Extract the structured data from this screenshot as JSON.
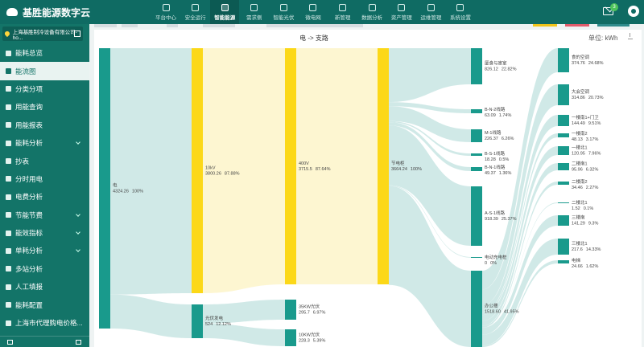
{
  "app": {
    "title": "基胜能源数字云"
  },
  "nav": [
    {
      "label": "平台中心"
    },
    {
      "label": "安全运行"
    },
    {
      "label": "智能能源",
      "active": true
    },
    {
      "label": "需求侧"
    },
    {
      "label": "智能光伏"
    },
    {
      "label": "微电网"
    },
    {
      "label": "新管理"
    },
    {
      "label": "数据分析"
    },
    {
      "label": "资产管理"
    },
    {
      "label": "运维管理"
    },
    {
      "label": "系统设置"
    }
  ],
  "header": {
    "notification_count": "3"
  },
  "site": {
    "selected": "上海基胜制冷设备有限公司-ho..."
  },
  "sidebar": {
    "items": [
      {
        "label": "能耗总览",
        "icon": "gauge-icon",
        "chevron": false
      },
      {
        "label": "能流图",
        "icon": "flow-icon",
        "chevron": false,
        "active": true
      },
      {
        "label": "分类分项",
        "icon": "bars-icon",
        "chevron": false
      },
      {
        "label": "用能查询",
        "icon": "grid-icon",
        "chevron": false
      },
      {
        "label": "用能报表",
        "icon": "table-icon",
        "chevron": false
      },
      {
        "label": "能耗分析",
        "icon": "chart-icon",
        "chevron": true
      },
      {
        "label": "抄表",
        "icon": "meter-icon",
        "chevron": false
      },
      {
        "label": "分时用电",
        "icon": "clock-icon",
        "chevron": false
      },
      {
        "label": "电费分析",
        "icon": "money-icon",
        "chevron": false
      },
      {
        "label": "节能节费",
        "icon": "leaf-icon",
        "chevron": true
      },
      {
        "label": "能效指标",
        "icon": "target-icon",
        "chevron": true
      },
      {
        "label": "单耗分析",
        "icon": "gear-icon",
        "chevron": true
      },
      {
        "label": "多站分析",
        "icon": "sites-icon",
        "chevron": false
      },
      {
        "label": "人工填报",
        "icon": "tools-icon",
        "chevron": false
      },
      {
        "label": "能耗配置",
        "icon": "config-icon",
        "chevron": false
      },
      {
        "label": "上海市代理购电价格...",
        "icon": "doc-icon",
        "chevron": false
      }
    ]
  },
  "card": {
    "title": "电 -> 支路",
    "unit": "单位: kWh"
  },
  "chart_data": {
    "type": "sankey",
    "title": "电 -> 支路",
    "unit": "kWh",
    "colors": {
      "node_teal": "#199a8c",
      "node_yellow": "#fcd818",
      "link_teal": "#cde8e6",
      "link_yellow": "#fdf6cf"
    },
    "nodes": [
      {
        "id": "dian",
        "label": "电",
        "value": "4324.26",
        "pct": "100%",
        "column": 0
      },
      {
        "id": "10kv",
        "label": "10kV",
        "value": "3800.26",
        "pct": "87.88%",
        "column": 1
      },
      {
        "id": "pv",
        "label": "光伏发电",
        "value": "524",
        "pct": "12.12%",
        "column": 1
      },
      {
        "id": "400v",
        "label": "400V",
        "value": "3715.5",
        "pct": "87.64%",
        "column": 2
      },
      {
        "id": "pv35",
        "label": "35KW光伏",
        "value": "295.7",
        "pct": "6.97%",
        "column": 2
      },
      {
        "id": "pv10",
        "label": "10KW光伏",
        "value": "228.3",
        "pct": "5.39%",
        "column": 2
      },
      {
        "id": "jdl",
        "label": "节电柜",
        "value": "3664.24",
        "pct": "100%",
        "column": 3
      },
      {
        "id": "fp",
        "label": "厦食与寄室",
        "value": "826.12",
        "pct": "22.82%",
        "column": 4
      },
      {
        "id": "bn2",
        "label": "B-N-2线路",
        "value": "63.09",
        "pct": "1.74%",
        "column": 4
      },
      {
        "id": "m1",
        "label": "M-1线路",
        "value": "226.37",
        "pct": "6.26%",
        "column": 4
      },
      {
        "id": "bs1",
        "label": "B-S-1线路",
        "value": "18.28",
        "pct": "0.5%",
        "column": 4
      },
      {
        "id": "bn1",
        "label": "B-N-1线路",
        "value": "49.37",
        "pct": "1.36%",
        "column": 4
      },
      {
        "id": "as1",
        "label": "A-S-1线路",
        "value": "918.39",
        "pct": "25.37%",
        "column": 4
      },
      {
        "id": "ev",
        "label": "电动充电桩",
        "value": "0",
        "pct": "0%",
        "column": 4
      },
      {
        "id": "office",
        "label": "办公楼",
        "value": "1518.60",
        "pct": "41.95%",
        "column": 4
      },
      {
        "id": "t1",
        "label": "食的空调",
        "value": "374.76",
        "pct": "24.68%",
        "column": 5
      },
      {
        "id": "t2",
        "label": "大会空调",
        "value": "314.86",
        "pct": "20.73%",
        "column": 5
      },
      {
        "id": "t3",
        "label": "一楼南1+门卫",
        "value": "144.49",
        "pct": "9.51%",
        "column": 5
      },
      {
        "id": "t4",
        "label": "一楼南2",
        "value": "48.13",
        "pct": "3.17%",
        "column": 5
      },
      {
        "id": "t5",
        "label": "一楼北1",
        "value": "120.95",
        "pct": "7.96%",
        "column": 5
      },
      {
        "id": "t6",
        "label": "二楼南1",
        "value": "95.96",
        "pct": "6.32%",
        "column": 5
      },
      {
        "id": "t7",
        "label": "二楼南2",
        "value": "34.46",
        "pct": "2.27%",
        "column": 5
      },
      {
        "id": "t8",
        "label": "二楼北1",
        "value": "1.52",
        "pct": "0.1%",
        "column": 5
      },
      {
        "id": "t9",
        "label": "三楼南",
        "value": "141.29",
        "pct": "9.3%",
        "column": 5
      },
      {
        "id": "t10",
        "label": "三楼北1",
        "value": "217.6",
        "pct": "14.33%",
        "column": 5
      },
      {
        "id": "t11",
        "label": "电梯",
        "value": "24.66",
        "pct": "1.62%",
        "column": 5
      }
    ],
    "links": [
      {
        "source": "dian",
        "target": "10kv",
        "value": 3800.26
      },
      {
        "source": "dian",
        "target": "pv",
        "value": 524
      },
      {
        "source": "10kv",
        "target": "400v",
        "value": 3715.5
      },
      {
        "source": "pv",
        "target": "pv35",
        "value": 295.7
      },
      {
        "source": "pv",
        "target": "pv10",
        "value": 228.3
      },
      {
        "source": "400v",
        "target": "jdl",
        "value": 3664.24
      },
      {
        "source": "jdl",
        "target": "fp",
        "value": 826.12
      },
      {
        "source": "jdl",
        "target": "bn2",
        "value": 63.09
      },
      {
        "source": "jdl",
        "target": "m1",
        "value": 226.37
      },
      {
        "source": "jdl",
        "target": "bs1",
        "value": 18.28
      },
      {
        "source": "jdl",
        "target": "bn1",
        "value": 49.37
      },
      {
        "source": "jdl",
        "target": "as1",
        "value": 918.39
      },
      {
        "source": "jdl",
        "target": "ev",
        "value": 0
      },
      {
        "source": "jdl",
        "target": "office",
        "value": 1518.6
      },
      {
        "source": "office",
        "target": "t1",
        "value": 374.76
      },
      {
        "source": "office",
        "target": "t2",
        "value": 314.86
      },
      {
        "source": "office",
        "target": "t3",
        "value": 144.49
      },
      {
        "source": "office",
        "target": "t4",
        "value": 48.13
      },
      {
        "source": "office",
        "target": "t5",
        "value": 120.95
      },
      {
        "source": "office",
        "target": "t6",
        "value": 95.96
      },
      {
        "source": "office",
        "target": "t7",
        "value": 34.46
      },
      {
        "source": "office",
        "target": "t8",
        "value": 1.52
      },
      {
        "source": "office",
        "target": "t9",
        "value": 141.29
      },
      {
        "source": "office",
        "target": "t10",
        "value": 217.6
      },
      {
        "source": "office",
        "target": "t11",
        "value": 24.66
      }
    ]
  }
}
